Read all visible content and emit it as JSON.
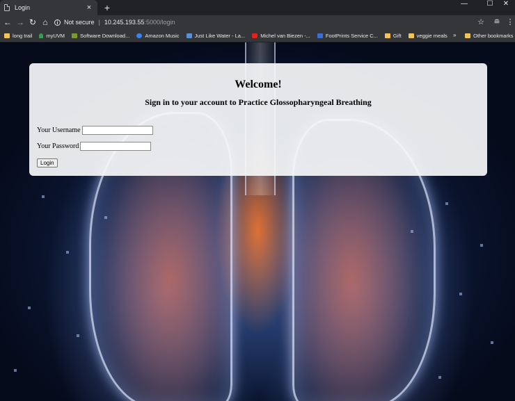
{
  "browser": {
    "tab_title": "Login",
    "tab_close": "×",
    "new_tab": "+",
    "window_controls": {
      "minimize": "—",
      "maximize": "☐",
      "close": "✕"
    },
    "security_label": "Not secure",
    "url_host": "10.245.193.55",
    "url_path": ":5000/login",
    "bookmarks": [
      {
        "label": "long trail",
        "icon": "folder-icon",
        "color": "#f2c35b"
      },
      {
        "label": "myUVM",
        "icon": "tree-icon",
        "color": "#3a9b4a"
      },
      {
        "label": "Software Download...",
        "icon": "v-logo-icon",
        "color": "#7a9b2a"
      },
      {
        "label": "Amazon Music",
        "icon": "music-icon",
        "color": "#3b82f6"
      },
      {
        "label": "Just Like Water - La...",
        "icon": "image-icon",
        "color": "#5a8fd6"
      },
      {
        "label": "Michel van Biezen -...",
        "icon": "youtube-icon",
        "color": "#e62117"
      },
      {
        "label": "FootPrints Service C...",
        "icon": "footprints-icon",
        "color": "#3d6fd1"
      },
      {
        "label": "Gift",
        "icon": "folder-icon",
        "color": "#f2c35b"
      },
      {
        "label": "veggie meals",
        "icon": "folder-icon",
        "color": "#f2c35b"
      }
    ],
    "bookmarks_more": "»",
    "other_bookmarks": "Other bookmarks"
  },
  "page": {
    "welcome": "Welcome!",
    "subtitle": "Sign in to your account to Practice Glossopharyngeal Breathing",
    "username_label": "Your Username",
    "password_label": "Your Password",
    "username_value": "",
    "password_value": "",
    "login_button": "Login"
  }
}
